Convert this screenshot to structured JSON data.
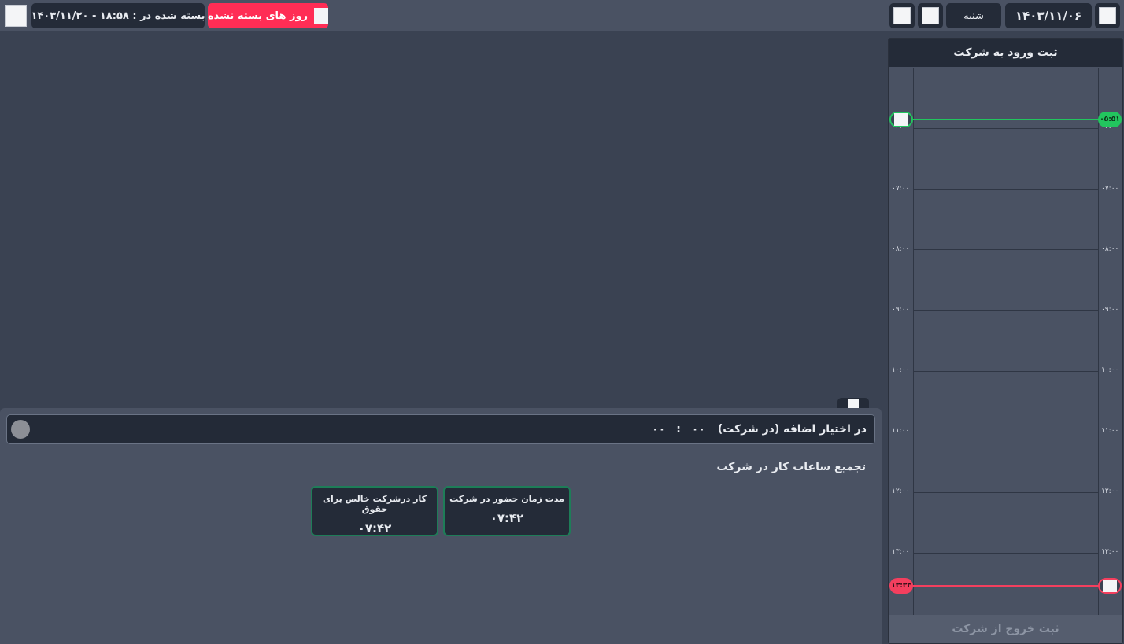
{
  "header": {
    "closed_at_label": "بسته شده در : ۱۸:۵۸ - ۱۴۰۳/۱۱/۲۰",
    "unclosed_days_label": "روز های بسته نشده",
    "date": "۱۴۰۳/۱۱/۰۶",
    "weekday": "شنبه"
  },
  "extra": {
    "label": "در اختیار اضافه (در شرکت)",
    "hours": "۰۰",
    "colon": ":",
    "minutes": "۰۰"
  },
  "summary": {
    "title": "تجمیع ساعات کار در شرکت",
    "cards": [
      {
        "title": "مدت زمان حضور در شرکت",
        "value": "۰۷:۴۲"
      },
      {
        "title": "کار درشرکت خالص برای حقوق",
        "value": "۰۷:۴۲"
      }
    ]
  },
  "timeline": {
    "header": "ثبت ورود به شرکت",
    "footer": "ثبت خروج از شرکت",
    "hours": [
      "۰۷:۰۰",
      "۰۸:۰۰",
      "۰۹:۰۰",
      "۱۰:۰۰",
      "۱۱:۰۰",
      "۱۲:۰۰",
      "۱۳:۰۰"
    ],
    "partial_label": "۰۶:۰۰",
    "check_in": "۰۵:۵۱",
    "check_out": "۱۳:۳۳",
    "check_in_color": "#22c55e",
    "check_out_color": "#f43f5e"
  },
  "colors": {
    "accent_red": "#ff2d55",
    "card_border": "#1e7d58"
  }
}
